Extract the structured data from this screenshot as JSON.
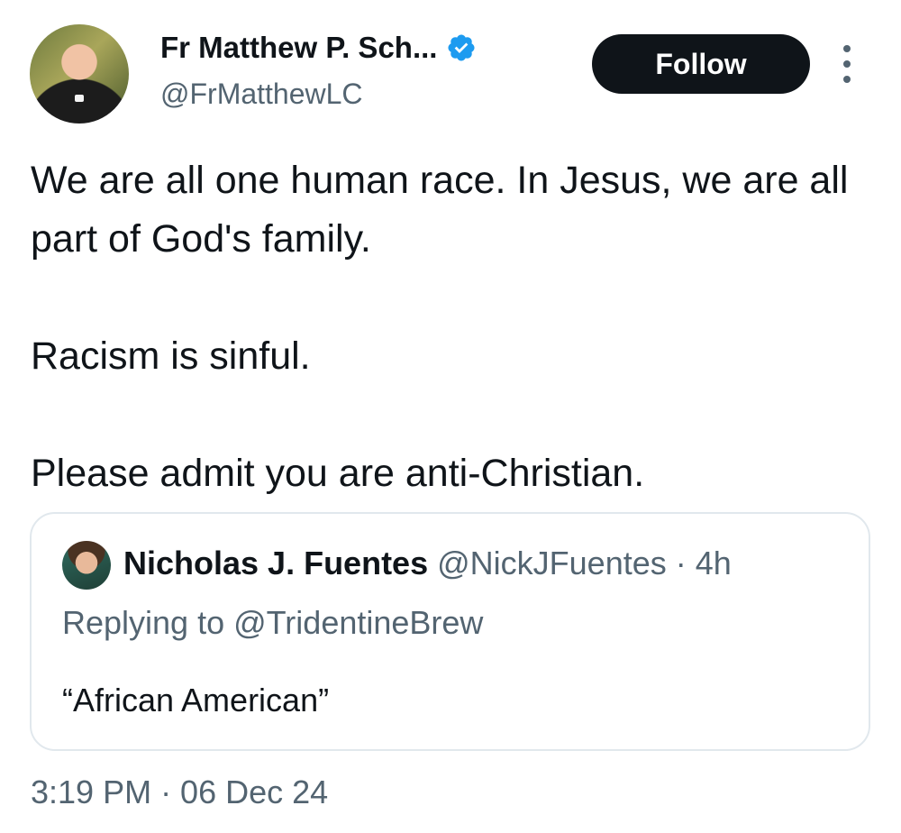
{
  "author": {
    "display_name": "Fr Matthew P. Sch...",
    "handle": "@FrMatthewLC",
    "verified_icon": "verified-badge-icon",
    "verified_color": "#1d9bf0"
  },
  "actions": {
    "follow_label": "Follow",
    "more_icon": "more-dots-icon"
  },
  "tweet": {
    "lines": [
      "We are all one human race. In Jesus, we are all part of God's family.",
      "Racism is sinful.",
      "Please admit you are anti-Christian."
    ],
    "timestamp": "3:19 PM · 06 Dec 24"
  },
  "quoted_tweet": {
    "display_name": "Nicholas J. Fuentes",
    "handle": "@NickJFuentes",
    "separator": "·",
    "time": "4h",
    "replying_to": "Replying to @TridentineBrew",
    "text": "“African American”"
  },
  "colors": {
    "text_primary": "#0f1419",
    "text_secondary": "#536471",
    "button_bg": "#0f1419",
    "border": "#e1e8ed"
  }
}
